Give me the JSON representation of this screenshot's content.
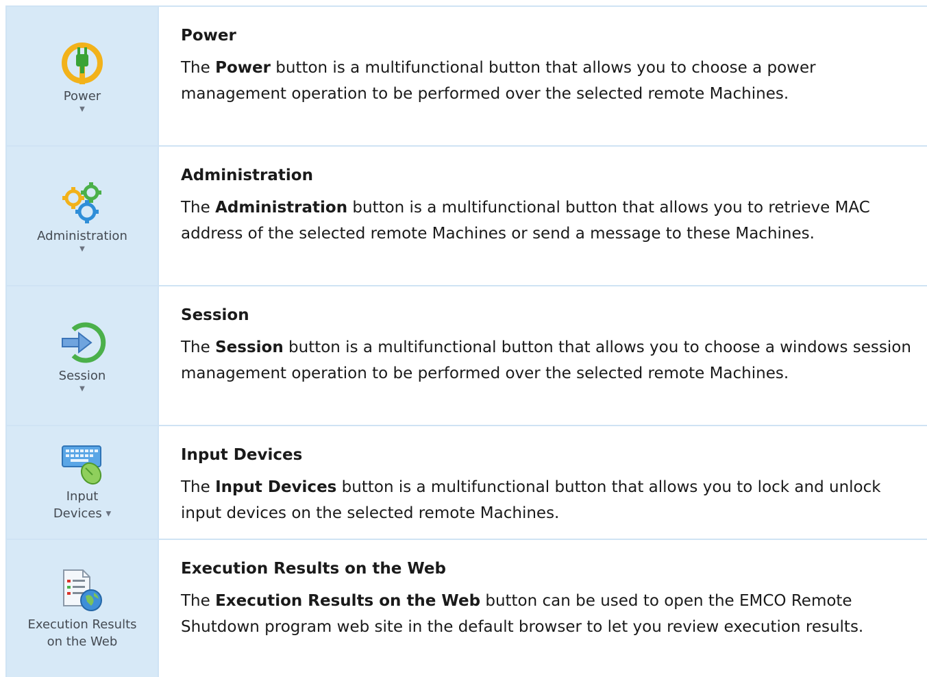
{
  "rows": [
    {
      "ribbon_label": "Power",
      "icon": "power-plug-icon",
      "title": "Power",
      "desc_prefix": "The ",
      "desc_bold": "Power",
      "desc_suffix": " button is a multifunctional button that allows you to choose a power management operation to be performed over the selected remote Machines."
    },
    {
      "ribbon_label": "Administration",
      "icon": "gears-icon",
      "title": "Administration",
      "desc_prefix": "The ",
      "desc_bold": "Administration",
      "desc_suffix": " button is a multifunctional button that allows you to retrieve MAC address of the selected remote Machines or send a message to these Machines."
    },
    {
      "ribbon_label": "Session",
      "icon": "session-arrow-icon",
      "title": "Session",
      "desc_prefix": "The ",
      "desc_bold": "Session",
      "desc_suffix": " button is a multifunctional button that allows you to choose a windows session management operation to be performed over the selected remote Machines."
    },
    {
      "ribbon_label_line1": "Input",
      "ribbon_label_line2": "Devices",
      "icon": "keyboard-mouse-icon",
      "title": "Input Devices",
      "desc_prefix": "The ",
      "desc_bold": "Input Devices",
      "desc_suffix": " button is a multifunctional button that allows you to lock and unlock input devices on the selected remote Machines."
    },
    {
      "ribbon_label_line1": "Execution Results",
      "ribbon_label_line2": "on the Web",
      "icon": "web-report-icon",
      "title": "Execution Results on the Web",
      "desc_prefix": "The ",
      "desc_bold": "Execution Results on the Web",
      "desc_suffix": " button can be used to open the EMCO Remote Shutdown program web site in the default browser to let you review execution results."
    }
  ],
  "colors": {
    "icon_cell_bg": "#d7e9f7",
    "border": "#cfe3f4"
  }
}
